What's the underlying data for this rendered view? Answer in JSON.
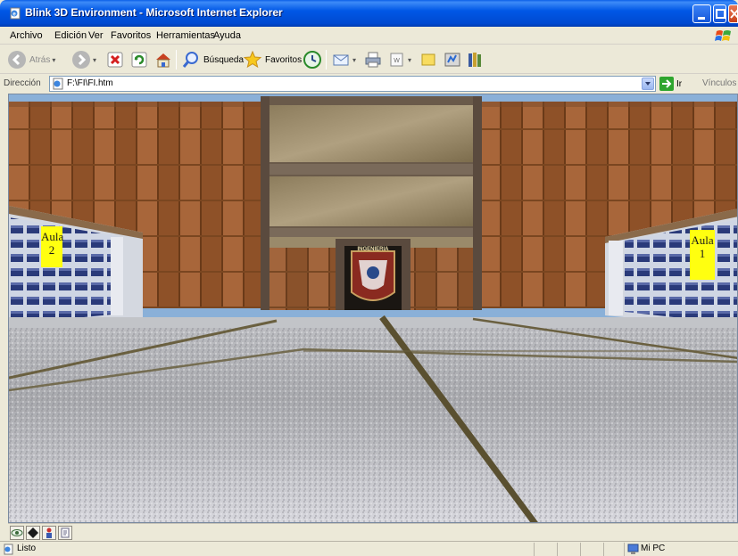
{
  "window": {
    "title": "Blink 3D Environment - Microsoft Internet Explorer"
  },
  "menu": {
    "items": [
      "Archivo",
      "Edición",
      "Ver",
      "Favoritos",
      "Herramientas",
      "Ayuda"
    ]
  },
  "toolbar": {
    "back_label": "Atrás",
    "search_label": "Búsqueda",
    "favorites_label": "Favoritos"
  },
  "address": {
    "label": "Dirección",
    "url": "F:\\FI\\FI.htm",
    "go_label": "Ir",
    "links_label": "Vínculos"
  },
  "scene": {
    "signs": {
      "left": {
        "word": "Aula",
        "number": "2"
      },
      "right": {
        "word": "Aula",
        "number": "1"
      }
    },
    "crest_text": "INGENIERIA",
    "colors": {
      "sky": "#8ab0d8",
      "brick": "#9a5a2e",
      "sign": "#ffff10"
    }
  },
  "status": {
    "text": "Listo",
    "zone": "Mi PC"
  }
}
